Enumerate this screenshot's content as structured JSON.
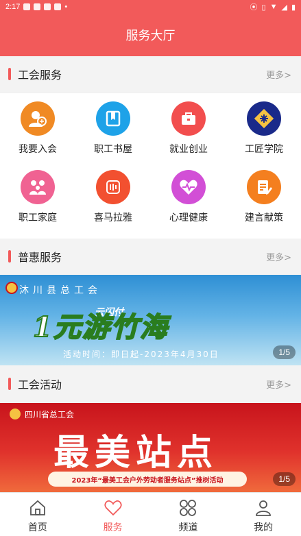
{
  "status_bar": {
    "time": "2:17"
  },
  "header": {
    "title": "服务大厅"
  },
  "sections": [
    {
      "title": "工会服务",
      "more": "更多>"
    },
    {
      "title": "普惠服务",
      "more": "更多>"
    },
    {
      "title": "工会活动",
      "more": "更多>"
    }
  ],
  "services": [
    {
      "label": "我要入会",
      "icon": "join-union-icon",
      "color": "#f08a24"
    },
    {
      "label": "职工书屋",
      "icon": "book-icon",
      "color": "#1ea2e8"
    },
    {
      "label": "就业创业",
      "icon": "briefcase-icon",
      "color": "#f24e4e"
    },
    {
      "label": "工匠学院",
      "icon": "academy-logo-icon",
      "color": "#1a2a8a"
    },
    {
      "label": "职工家庭",
      "icon": "family-icon",
      "color": "#f06292"
    },
    {
      "label": "喜马拉雅",
      "icon": "ximalaya-icon",
      "color": "#f25030"
    },
    {
      "label": "心理健康",
      "icon": "heart-pulse-icon",
      "color": "#d24fd6"
    },
    {
      "label": "建言献策",
      "icon": "suggestion-icon",
      "color": "#f47f1f"
    }
  ],
  "banner1": {
    "org": "沐川县总工会",
    "top_text": "云闪付",
    "main_text": "1元游竹海",
    "activity": "活动时间：即日起-2023年4月30日",
    "pager": "1/5"
  },
  "banner2": {
    "org": "四川省总工会",
    "main_text": "最美站点",
    "strip": "2023年“最美工会户外劳动者服务站点”推树活动",
    "pager": "1/5"
  },
  "tabs": [
    {
      "label": "首页",
      "icon": "home-icon"
    },
    {
      "label": "服务",
      "icon": "heart-icon",
      "active": true
    },
    {
      "label": "频道",
      "icon": "channels-icon"
    },
    {
      "label": "我的",
      "icon": "profile-icon"
    }
  ],
  "colors": {
    "primary": "#f25a5a",
    "section_bg": "#f3f3f3"
  }
}
